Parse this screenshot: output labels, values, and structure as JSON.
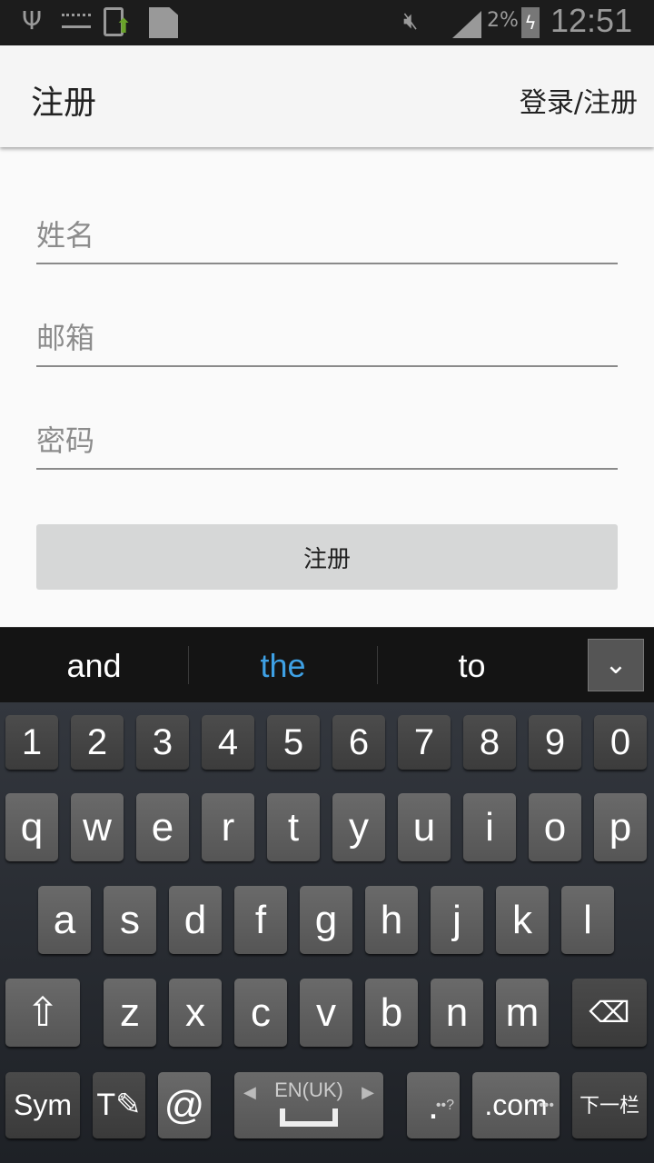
{
  "status_bar": {
    "icons": [
      "usb-icon",
      "keyboard-icon",
      "phone-upload-icon",
      "sim-alert-icon",
      "mute-icon",
      "signal-icon",
      "battery-charging-icon"
    ],
    "battery": "2%",
    "time": "12:51"
  },
  "app_bar": {
    "title": "注册",
    "action": "登录/注册"
  },
  "form": {
    "name_placeholder": "姓名",
    "email_placeholder": "邮箱",
    "password_placeholder": "密码",
    "submit": "注册"
  },
  "keyboard": {
    "suggestions": [
      "and",
      "the",
      "to"
    ],
    "suggestion_highlight": "#3ea0e4",
    "number_row": [
      "1",
      "2",
      "3",
      "4",
      "5",
      "6",
      "7",
      "8",
      "9",
      "0"
    ],
    "row1": [
      "q",
      "w",
      "e",
      "r",
      "t",
      "y",
      "u",
      "i",
      "o",
      "p"
    ],
    "row2": [
      "a",
      "s",
      "d",
      "f",
      "g",
      "h",
      "j",
      "k",
      "l"
    ],
    "row3": [
      "z",
      "x",
      "c",
      "v",
      "b",
      "n",
      "m"
    ],
    "sym": "Sym",
    "at": "@",
    "language": "EN(UK)",
    "period": ".",
    "period_hint": "••?",
    "dotcom": ".com",
    "dotcom_hint": "•••",
    "next": "下一栏"
  }
}
